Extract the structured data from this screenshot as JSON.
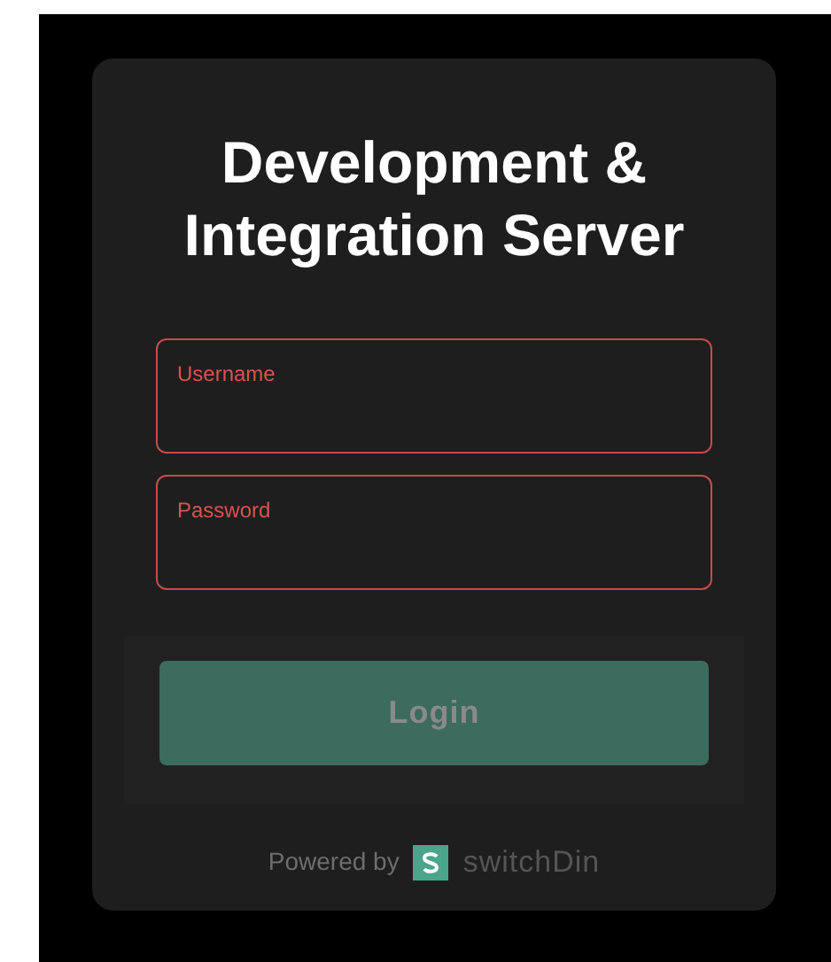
{
  "title": "Development & Integration Server",
  "fields": [
    {
      "label": "Username",
      "invalid": true
    },
    {
      "label": "Password",
      "invalid": true
    }
  ],
  "login_button": {
    "label": "Login",
    "disabled": true
  },
  "footer": {
    "powered_by": "Powered by",
    "brand": "switchDin"
  }
}
